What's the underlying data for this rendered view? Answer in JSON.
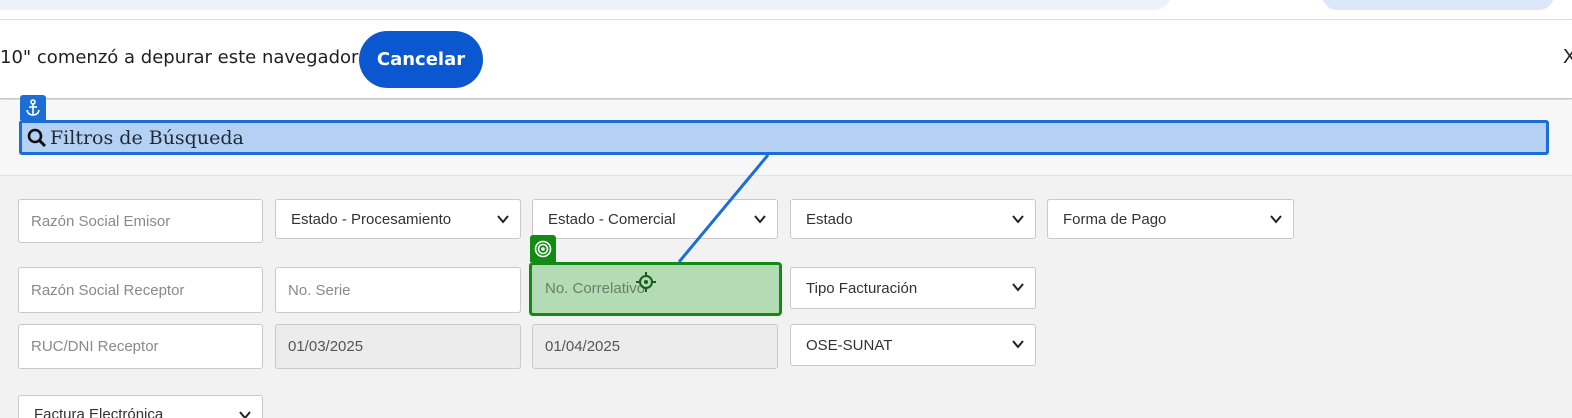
{
  "infobar": {
    "message": "10\" comenzó a depurar este navegador",
    "cancel_label": "Cancelar",
    "close_glyph": "X"
  },
  "filters": {
    "title": "Filtros de Búsqueda",
    "icon": "search-icon",
    "anchor_icon": "anchor-icon"
  },
  "fields": {
    "razon_social_emisor": {
      "placeholder": "Razón Social Emisor"
    },
    "estado_procesamiento": {
      "value": "Estado - Procesamiento"
    },
    "estado_comercial": {
      "value": "Estado - Comercial"
    },
    "estado": {
      "value": "Estado"
    },
    "forma_pago": {
      "value": "Forma de Pago"
    },
    "razon_social_receptor": {
      "placeholder": "Razón Social Receptor"
    },
    "no_serie": {
      "placeholder": "No. Serie"
    },
    "no_correlativo": {
      "placeholder": "No. Correlativo"
    },
    "tipo_facturacion": {
      "value": "Tipo Facturación"
    },
    "ruc_dni_receptor": {
      "placeholder": "RUC/DNI Receptor"
    },
    "fecha_desde": {
      "value": "01/03/2025"
    },
    "fecha_hasta": {
      "value": "01/04/2025"
    },
    "ose": {
      "value": "OSE-SUNAT"
    },
    "tipo_documento": {
      "value": "Factura Electrónica"
    }
  },
  "colors": {
    "accent": "#0b57d0",
    "anchor_highlight": "#1a6ed6",
    "target_highlight": "#138a13"
  }
}
